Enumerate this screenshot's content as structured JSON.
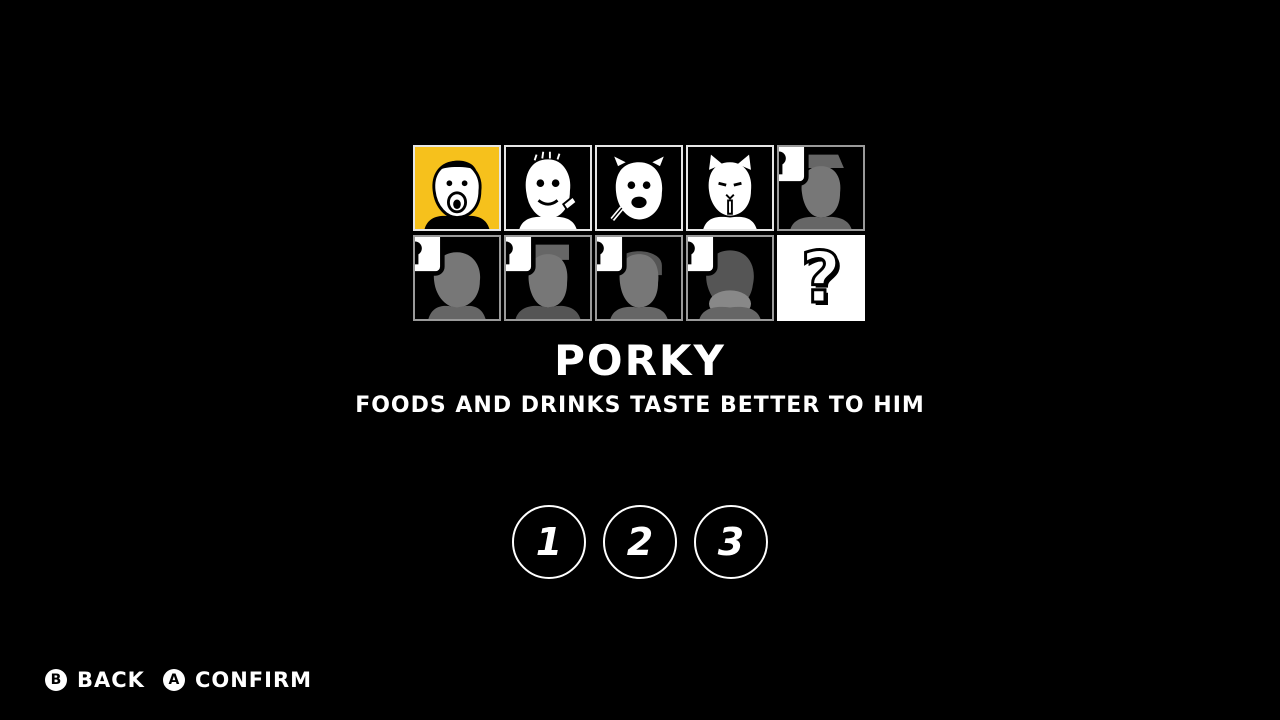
{
  "character": {
    "name": "PORKY",
    "description": "FOODS AND DRINKS TASTE BETTER TO HIM"
  },
  "grid": {
    "cells": [
      {
        "state": "selected",
        "icon": "character-portrait-icon"
      },
      {
        "state": "unlocked",
        "icon": "character-portrait-icon"
      },
      {
        "state": "unlocked",
        "icon": "character-portrait-icon"
      },
      {
        "state": "unlocked",
        "icon": "character-portrait-icon"
      },
      {
        "state": "locked",
        "icon": "padlock-icon"
      },
      {
        "state": "locked",
        "icon": "padlock-icon"
      },
      {
        "state": "locked",
        "icon": "padlock-icon"
      },
      {
        "state": "locked",
        "icon": "padlock-icon"
      },
      {
        "state": "locked",
        "icon": "padlock-icon"
      },
      {
        "state": "mystery",
        "label": "?"
      }
    ]
  },
  "slots": [
    "1",
    "2",
    "3"
  ],
  "footer": {
    "back": {
      "glyph": "B",
      "label": "BACK"
    },
    "confirm": {
      "glyph": "A",
      "label": "CONFIRM"
    }
  },
  "colors": {
    "background": "#000000",
    "selected": "#f6c11c",
    "text": "#ffffff"
  }
}
